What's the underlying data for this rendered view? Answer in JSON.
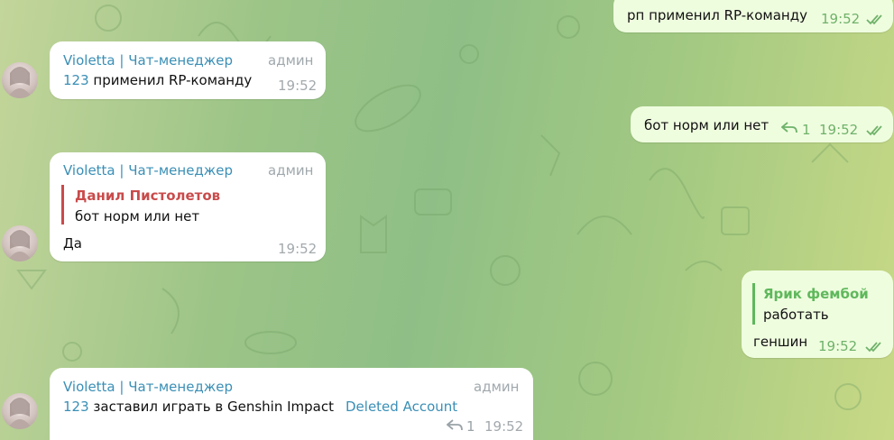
{
  "theme": {
    "accent": "#3a8fb6",
    "outgoing_bg": "#effddf",
    "check_color": "#6fb26a",
    "reply_red": "#c94b4b",
    "reply_green": "#5fb85c"
  },
  "messages": {
    "out1": {
      "text": "рп применил RP-команду",
      "time": "19:52"
    },
    "in1": {
      "sender": "Violetta | Чат-менеджер",
      "role": "админ",
      "link": "123",
      "text": " применил RP-команду",
      "time": "19:52"
    },
    "out2": {
      "text": "бот норм или нет",
      "reply_count": "1",
      "time": "19:52"
    },
    "in2": {
      "sender": "Violetta | Чат-менеджер",
      "role": "админ",
      "quote_name": "Данил Пистолетов",
      "quote_text": "бот норм или нет",
      "text": "Да",
      "time": "19:52"
    },
    "out3": {
      "quote_name": "Ярик фембой",
      "quote_text": "работать",
      "text": "геншин",
      "time": "19:52"
    },
    "in3": {
      "sender": "Violetta | Чат-менеджер",
      "role": "админ",
      "link": "123",
      "text": " заставил играть в Genshin Impact",
      "deleted": "Deleted Account",
      "reply_count": "1",
      "time": "19:52"
    }
  },
  "icons": {
    "read_status": "double-check-icon",
    "reply": "reply-arrow-icon",
    "avatar": "avatar"
  }
}
